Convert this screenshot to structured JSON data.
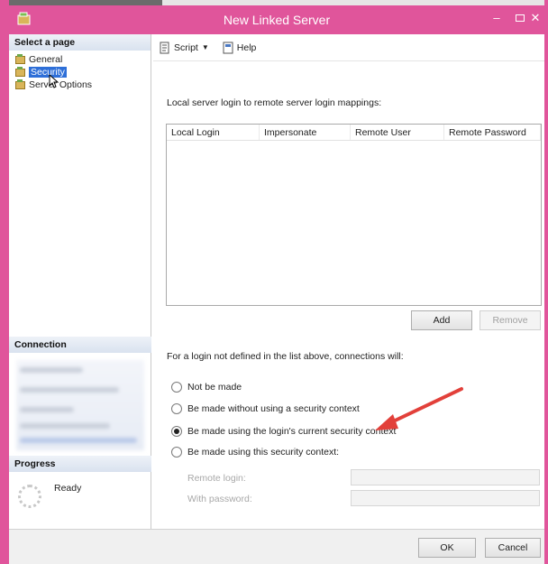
{
  "window": {
    "title": "New Linked Server",
    "minimize_glyph": "–",
    "close_glyph": "✕",
    "accent_color": "#e0559b"
  },
  "sidebar": {
    "select_page_header": "Select a page",
    "pages": [
      {
        "label": "General",
        "icon": "page-icon"
      },
      {
        "label": "Security",
        "icon": "page-icon",
        "selected": true
      },
      {
        "label": "Server Options",
        "icon": "page-icon"
      }
    ],
    "connection_header": "Connection",
    "progress_header": "Progress",
    "progress_status": "Ready"
  },
  "toolbar": {
    "script_label": "Script",
    "help_label": "Help"
  },
  "security": {
    "mapping_label": "Local server login to remote server login mappings:",
    "columns": [
      "Local Login",
      "Impersonate",
      "Remote User",
      "Remote Password"
    ],
    "add_label": "Add",
    "remove_label": "Remove",
    "connections_label": "For a login not defined in the list above, connections will:",
    "options": [
      {
        "label": "Not be made",
        "checked": false
      },
      {
        "label": "Be made without using a security context",
        "checked": false
      },
      {
        "label": "Be made using the login's current security context",
        "checked": true
      },
      {
        "label": "Be made using this security context:",
        "checked": false
      }
    ],
    "remote_login_label": "Remote login:",
    "with_password_label": "With password:"
  },
  "footer": {
    "ok_label": "OK",
    "cancel_label": "Cancel"
  },
  "annotation": {
    "arrow_color": "#e2403a"
  }
}
